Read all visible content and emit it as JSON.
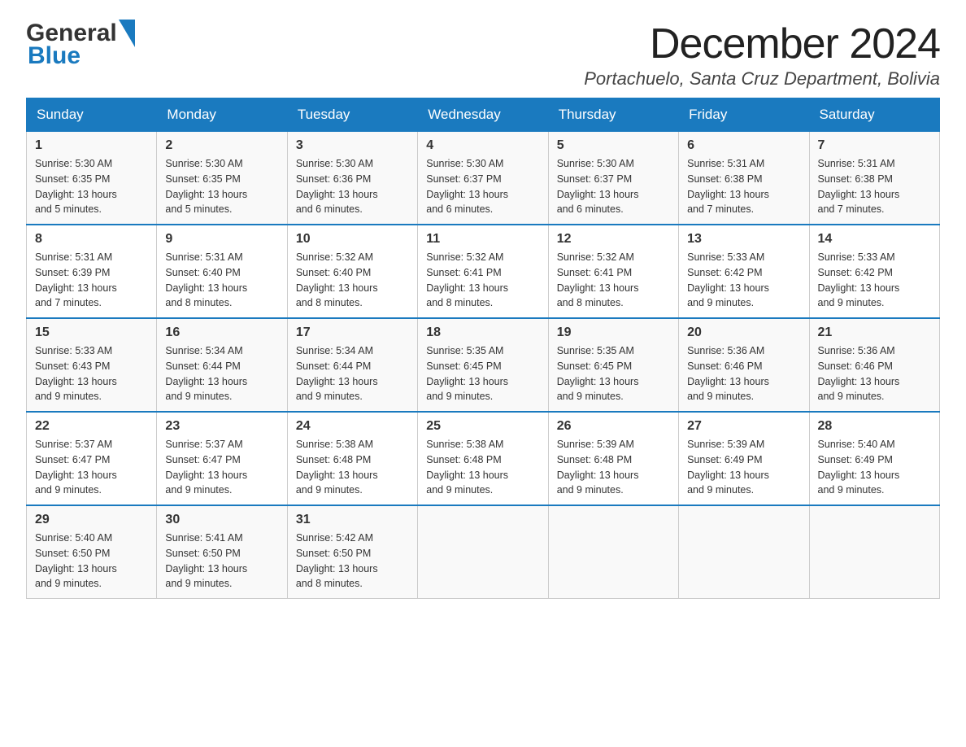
{
  "header": {
    "logo_general": "General",
    "logo_blue": "Blue",
    "month_title": "December 2024",
    "location": "Portachuelo, Santa Cruz Department, Bolivia"
  },
  "days_of_week": [
    "Sunday",
    "Monday",
    "Tuesday",
    "Wednesday",
    "Thursday",
    "Friday",
    "Saturday"
  ],
  "weeks": [
    [
      {
        "day": "1",
        "sunrise": "5:30 AM",
        "sunset": "6:35 PM",
        "daylight": "13 hours and 5 minutes."
      },
      {
        "day": "2",
        "sunrise": "5:30 AM",
        "sunset": "6:35 PM",
        "daylight": "13 hours and 5 minutes."
      },
      {
        "day": "3",
        "sunrise": "5:30 AM",
        "sunset": "6:36 PM",
        "daylight": "13 hours and 6 minutes."
      },
      {
        "day": "4",
        "sunrise": "5:30 AM",
        "sunset": "6:37 PM",
        "daylight": "13 hours and 6 minutes."
      },
      {
        "day": "5",
        "sunrise": "5:30 AM",
        "sunset": "6:37 PM",
        "daylight": "13 hours and 6 minutes."
      },
      {
        "day": "6",
        "sunrise": "5:31 AM",
        "sunset": "6:38 PM",
        "daylight": "13 hours and 7 minutes."
      },
      {
        "day": "7",
        "sunrise": "5:31 AM",
        "sunset": "6:38 PM",
        "daylight": "13 hours and 7 minutes."
      }
    ],
    [
      {
        "day": "8",
        "sunrise": "5:31 AM",
        "sunset": "6:39 PM",
        "daylight": "13 hours and 7 minutes."
      },
      {
        "day": "9",
        "sunrise": "5:31 AM",
        "sunset": "6:40 PM",
        "daylight": "13 hours and 8 minutes."
      },
      {
        "day": "10",
        "sunrise": "5:32 AM",
        "sunset": "6:40 PM",
        "daylight": "13 hours and 8 minutes."
      },
      {
        "day": "11",
        "sunrise": "5:32 AM",
        "sunset": "6:41 PM",
        "daylight": "13 hours and 8 minutes."
      },
      {
        "day": "12",
        "sunrise": "5:32 AM",
        "sunset": "6:41 PM",
        "daylight": "13 hours and 8 minutes."
      },
      {
        "day": "13",
        "sunrise": "5:33 AM",
        "sunset": "6:42 PM",
        "daylight": "13 hours and 9 minutes."
      },
      {
        "day": "14",
        "sunrise": "5:33 AM",
        "sunset": "6:42 PM",
        "daylight": "13 hours and 9 minutes."
      }
    ],
    [
      {
        "day": "15",
        "sunrise": "5:33 AM",
        "sunset": "6:43 PM",
        "daylight": "13 hours and 9 minutes."
      },
      {
        "day": "16",
        "sunrise": "5:34 AM",
        "sunset": "6:44 PM",
        "daylight": "13 hours and 9 minutes."
      },
      {
        "day": "17",
        "sunrise": "5:34 AM",
        "sunset": "6:44 PM",
        "daylight": "13 hours and 9 minutes."
      },
      {
        "day": "18",
        "sunrise": "5:35 AM",
        "sunset": "6:45 PM",
        "daylight": "13 hours and 9 minutes."
      },
      {
        "day": "19",
        "sunrise": "5:35 AM",
        "sunset": "6:45 PM",
        "daylight": "13 hours and 9 minutes."
      },
      {
        "day": "20",
        "sunrise": "5:36 AM",
        "sunset": "6:46 PM",
        "daylight": "13 hours and 9 minutes."
      },
      {
        "day": "21",
        "sunrise": "5:36 AM",
        "sunset": "6:46 PM",
        "daylight": "13 hours and 9 minutes."
      }
    ],
    [
      {
        "day": "22",
        "sunrise": "5:37 AM",
        "sunset": "6:47 PM",
        "daylight": "13 hours and 9 minutes."
      },
      {
        "day": "23",
        "sunrise": "5:37 AM",
        "sunset": "6:47 PM",
        "daylight": "13 hours and 9 minutes."
      },
      {
        "day": "24",
        "sunrise": "5:38 AM",
        "sunset": "6:48 PM",
        "daylight": "13 hours and 9 minutes."
      },
      {
        "day": "25",
        "sunrise": "5:38 AM",
        "sunset": "6:48 PM",
        "daylight": "13 hours and 9 minutes."
      },
      {
        "day": "26",
        "sunrise": "5:39 AM",
        "sunset": "6:48 PM",
        "daylight": "13 hours and 9 minutes."
      },
      {
        "day": "27",
        "sunrise": "5:39 AM",
        "sunset": "6:49 PM",
        "daylight": "13 hours and 9 minutes."
      },
      {
        "day": "28",
        "sunrise": "5:40 AM",
        "sunset": "6:49 PM",
        "daylight": "13 hours and 9 minutes."
      }
    ],
    [
      {
        "day": "29",
        "sunrise": "5:40 AM",
        "sunset": "6:50 PM",
        "daylight": "13 hours and 9 minutes."
      },
      {
        "day": "30",
        "sunrise": "5:41 AM",
        "sunset": "6:50 PM",
        "daylight": "13 hours and 9 minutes."
      },
      {
        "day": "31",
        "sunrise": "5:42 AM",
        "sunset": "6:50 PM",
        "daylight": "13 hours and 8 minutes."
      },
      null,
      null,
      null,
      null
    ]
  ],
  "labels": {
    "sunrise": "Sunrise:",
    "sunset": "Sunset:",
    "daylight": "Daylight:"
  }
}
